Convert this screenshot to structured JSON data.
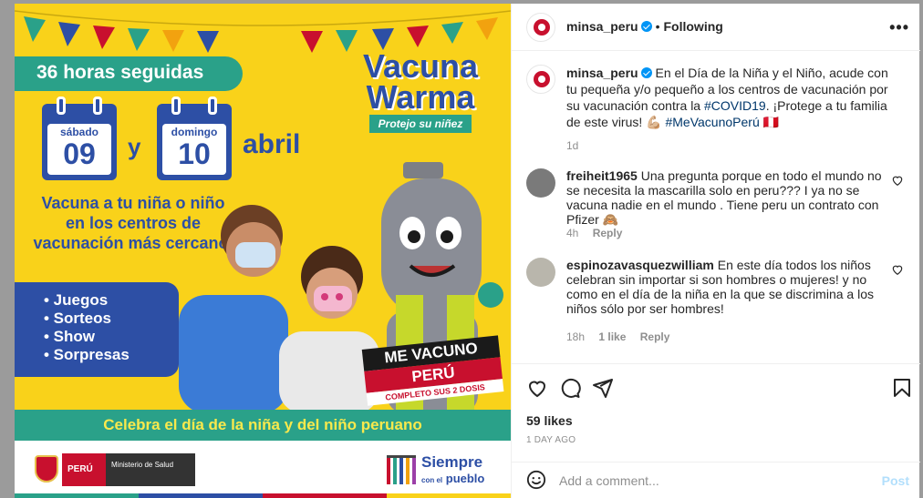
{
  "post": {
    "username": "minsa_peru",
    "verified": true,
    "follow_state": "Following",
    "more_icon": "more-horizontal-icon",
    "separator": "•"
  },
  "media": {
    "ribbon": "36 horas seguidas",
    "day1_name": "sábado",
    "day1_num": "09",
    "conj": "y",
    "day2_name": "domingo",
    "day2_num": "10",
    "month": "abril",
    "brand_line1": "Vacuna",
    "brand_line2": "Warma",
    "brand_tag": "Protejo su niñez",
    "invite": "Vacuna a tu niña o niño en los centros de vacunación más cercano.",
    "perks": [
      "• Juegos",
      "• Sorteos",
      "• Show",
      "• Sorpresas"
    ],
    "stamp_l1": "ME VACUNO",
    "stamp_l2": "PERÚ",
    "stamp_l3": "COMPLETO SUS 2 DOSIS",
    "band": "Celebra el día de la niña y del niño peruano",
    "footer_peru": "PERÚ",
    "footer_ministry": "Ministerio de Salud",
    "footer_siempre": "Siempre",
    "footer_pueblo_prefix": "con el",
    "footer_pueblo": "pueblo",
    "colors": {
      "yellow": "#f9d21a",
      "teal": "#2aa189",
      "blue": "#2d4fa5",
      "red": "#c8102e"
    }
  },
  "caption": {
    "username": "minsa_peru",
    "text_before": "En el Día de la Niña y el Niño, acude con tu pequeña y/o pequeño a los centros de vacunación por su vacunación contra la ",
    "hashtag1": "#COVID19",
    "text_after": ". ¡Protege a tu familia de este virus! 💪🏼",
    "hashtag2": "#MeVacunoPerú",
    "flag": "🇵🇪",
    "time": "1d"
  },
  "comments": [
    {
      "username": "freiheit1965",
      "text": "Una pregunta porque en todo el mundo no se necesita la mascarilla solo en peru??? I ya no se vacuna nadie en el mundo . Tiene peru un contrato con Pfizer 🙈",
      "time": "4h",
      "likes": "",
      "reply": "Reply"
    },
    {
      "username": "espinozavasquezwilliam",
      "text": "En este día todos los niños celebran sin importar si son hombres o mujeres! y no como en el día de la niña en la que se discrimina a los niños sólo por ser hombres!",
      "time": "18h",
      "likes": "1 like",
      "reply": "Reply"
    }
  ],
  "actions": {
    "like_icon": "heart-icon",
    "comment_icon": "comment-icon",
    "share_icon": "share-icon",
    "save_icon": "bookmark-icon",
    "likes": "59 likes",
    "time_ago": "1 DAY AGO"
  },
  "comment_box": {
    "placeholder": "Add a comment...",
    "post_label": "Post",
    "emoji_icon": "emoji-icon"
  }
}
